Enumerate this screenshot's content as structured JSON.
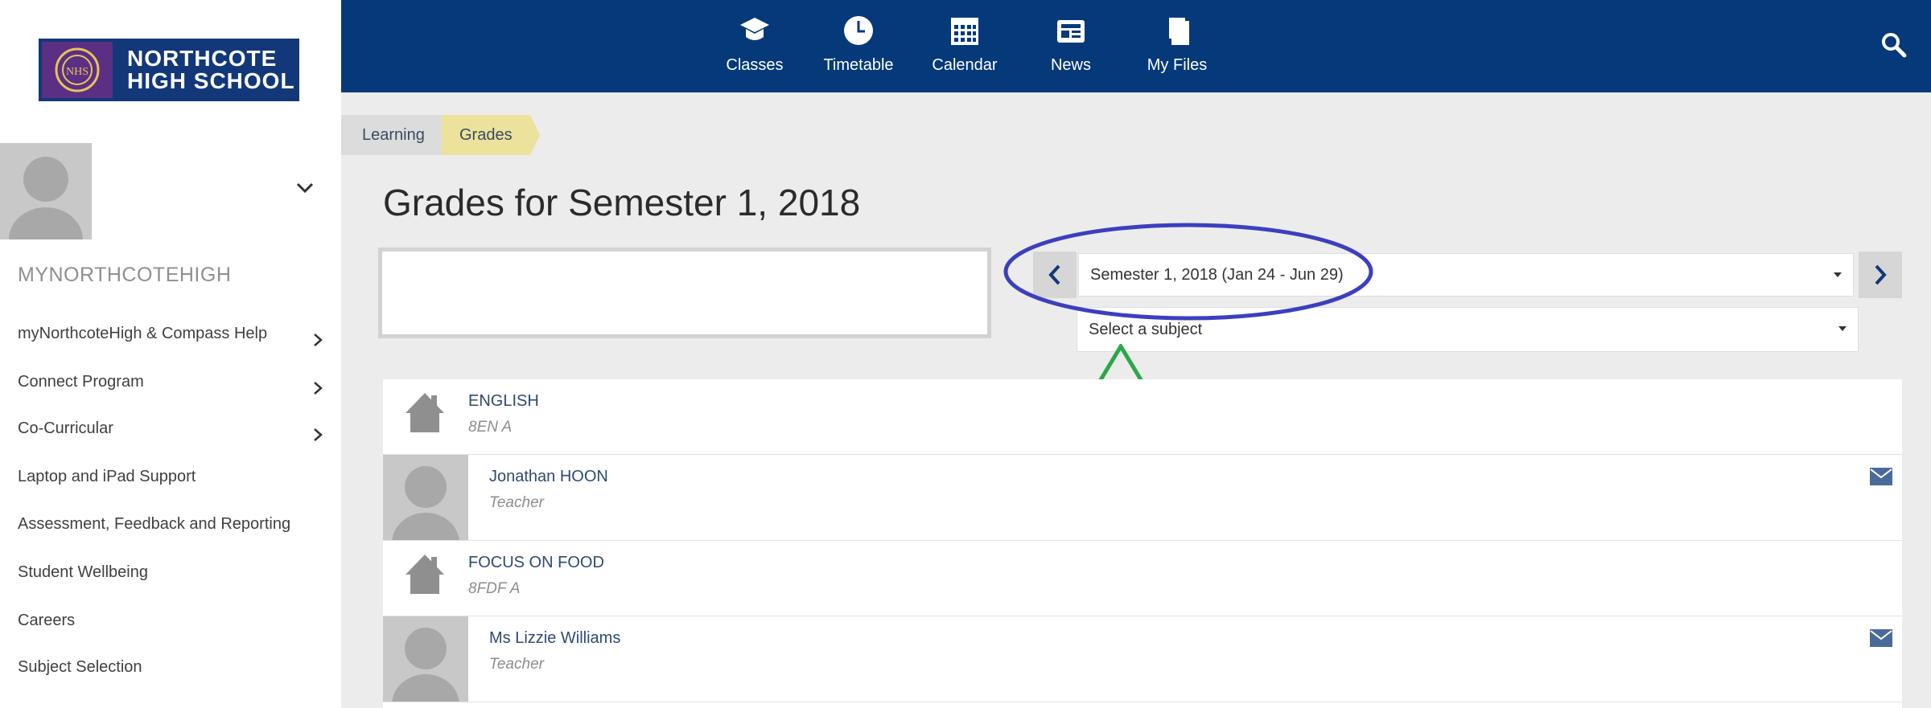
{
  "logo": {
    "line1": "NORTHCOTE",
    "line2": "HIGH SCHOOL"
  },
  "topnav": {
    "items": [
      {
        "label": "Classes",
        "icon": "graduation-cap-icon"
      },
      {
        "label": "Timetable",
        "icon": "clock-icon"
      },
      {
        "label": "Calendar",
        "icon": "calendar-icon"
      },
      {
        "label": "News",
        "icon": "news-icon"
      },
      {
        "label": "My Files",
        "icon": "files-icon"
      }
    ],
    "search_icon": "search-icon",
    "background": "#05397a"
  },
  "sidebar": {
    "heading": "MYNORTHCOTEHIGH",
    "items": [
      {
        "label": "myNorthcoteHigh & Compass Help",
        "has_submenu": true
      },
      {
        "label": "Connect Program",
        "has_submenu": true
      },
      {
        "label": "Co-Curricular",
        "has_submenu": true
      },
      {
        "label": "Laptop and iPad Support",
        "has_submenu": false
      },
      {
        "label": "Assessment, Feedback and Reporting",
        "has_submenu": false
      },
      {
        "label": "Student Wellbeing",
        "has_submenu": false
      },
      {
        "label": "Careers",
        "has_submenu": false
      },
      {
        "label": "Subject Selection",
        "has_submenu": false
      }
    ]
  },
  "breadcrumb": {
    "items": [
      "Learning",
      "Grades"
    ]
  },
  "page": {
    "title": "Grades for Semester 1, 2018"
  },
  "period_selector": {
    "selected": "Semester 1, 2018 (Jan 24 - Jun 29)",
    "subject_placeholder": "Select a subject"
  },
  "annotations": {
    "ellipse_color": "#3b3fbf",
    "arrow_color": "#2aa84a"
  },
  "classes": [
    {
      "subject": "ENGLISH",
      "code": "8EN A",
      "teacher": "Jonathan HOON",
      "teacher_role": "Teacher"
    },
    {
      "subject": "FOCUS ON FOOD",
      "code": "8FDF A",
      "teacher": "Ms Lizzie Williams",
      "teacher_role": "Teacher"
    }
  ]
}
